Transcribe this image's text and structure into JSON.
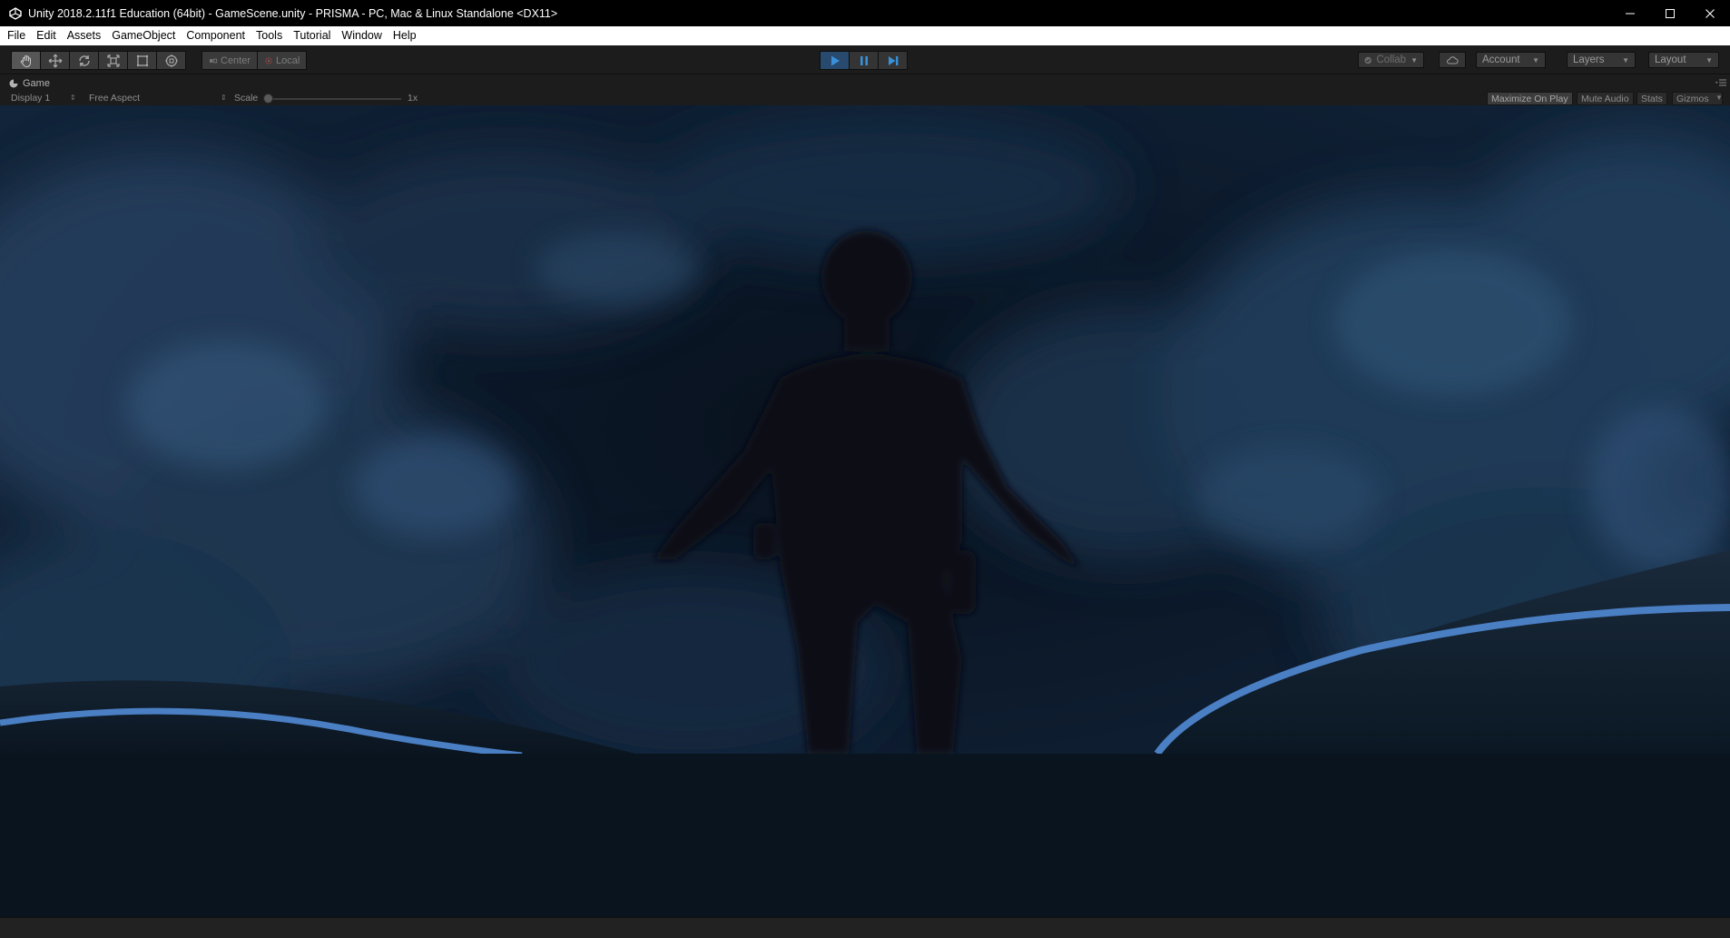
{
  "window": {
    "title": "Unity 2018.2.11f1 Education (64bit) - GameScene.unity - PRISMA - PC, Mac & Linux Standalone <DX11>"
  },
  "menubar": {
    "items": [
      "File",
      "Edit",
      "Assets",
      "GameObject",
      "Component",
      "Tools",
      "Tutorial",
      "Window",
      "Help"
    ]
  },
  "toolbar": {
    "pivot_label": "Center",
    "space_label": "Local",
    "collab_label": "Collab",
    "account_label": "Account",
    "layers_label": "Layers",
    "layout_label": "Layout",
    "play_state": "playing",
    "accent_color": "#3a8fd9"
  },
  "game_view": {
    "tab_label": "Game",
    "display_label": "Display 1",
    "aspect_label": "Free Aspect",
    "scale_label": "Scale",
    "scale_value": "1x",
    "maximize_label": "Maximize On Play",
    "mute_label": "Mute Audio",
    "stats_label": "Stats",
    "gizmos_label": "Gizmos"
  }
}
